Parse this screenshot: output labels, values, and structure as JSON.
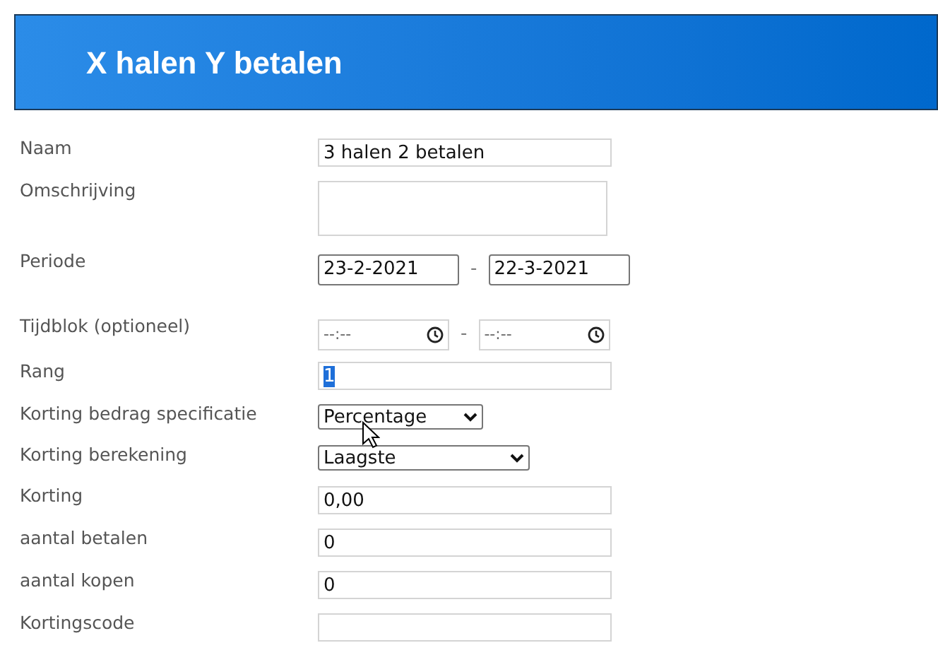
{
  "header": {
    "title": "X halen Y betalen"
  },
  "fields": [
    {
      "kind": "text",
      "label": "Naam",
      "value": "3 halen 2 betalen"
    },
    {
      "kind": "textarea",
      "label": "Omschrijving"
    },
    {
      "kind": "date_range",
      "label": "Periode",
      "from": "23-2-2021",
      "separator": "-",
      "to": "22-3-2021"
    },
    {
      "kind": "time_range",
      "label": "Tijdblok (optioneel)",
      "from_placeholder": "--:--",
      "separator": "-",
      "to_placeholder": "--:--"
    },
    {
      "kind": "text",
      "label": "Rang",
      "value": "1",
      "highlighted": true
    },
    {
      "kind": "select",
      "label": "Korting bedrag specificatie",
      "value": "Percentage"
    },
    {
      "kind": "select",
      "label": "Korting berekening",
      "value": "Laagste"
    },
    {
      "kind": "text",
      "label": "Korting",
      "value": "0,00"
    },
    {
      "kind": "text",
      "label": "aantal betalen",
      "value": "0"
    },
    {
      "kind": "text",
      "label": "aantal kopen",
      "value": "0"
    },
    {
      "kind": "text",
      "label": "Kortingscode"
    }
  ]
}
